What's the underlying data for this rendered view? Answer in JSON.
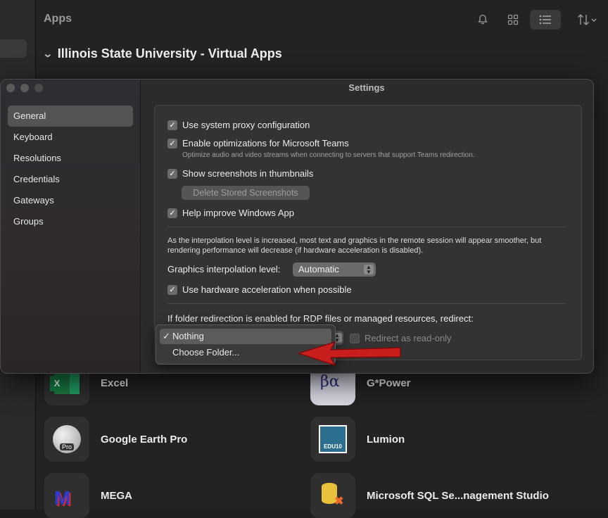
{
  "background": {
    "title": "Apps",
    "toolbar_icons": [
      "bell-icon",
      "grid-icon",
      "list-icon",
      "sort-icon"
    ],
    "group": {
      "name": "Illinois State University - Virtual Apps",
      "chevron": "chevron-down"
    },
    "apps": [
      {
        "name": "Excel",
        "icon": "excel-icon",
        "icon_text": "X"
      },
      {
        "name": "G*Power",
        "icon": "gpower-icon",
        "icon_text": "βα"
      },
      {
        "name": "Google Earth Pro",
        "icon": "google-earth-icon",
        "icon_text": "Pro"
      },
      {
        "name": "Lumion",
        "icon": "lumion-icon",
        "icon_text": "EDU10"
      },
      {
        "name": "MEGA",
        "icon": "mega-icon",
        "icon_text": "M"
      },
      {
        "name": "Microsoft SQL Se...nagement Studio",
        "icon": "sql-server-icon",
        "icon_text": ""
      }
    ]
  },
  "settings": {
    "title": "Settings",
    "sidebar": [
      {
        "label": "General",
        "active": true
      },
      {
        "label": "Keyboard"
      },
      {
        "label": "Resolutions"
      },
      {
        "label": "Credentials"
      },
      {
        "label": "Gateways"
      },
      {
        "label": "Groups"
      }
    ],
    "general": {
      "use_system_proxy": {
        "label": "Use system proxy configuration",
        "checked": true
      },
      "teams_opt": {
        "label": "Enable optimizations for Microsoft Teams",
        "checked": true,
        "description": "Optimize audio and video streams when connecting to servers that support Teams redirection."
      },
      "screenshots": {
        "label": "Show screenshots in thumbnails",
        "checked": true
      },
      "delete_screenshots_button": "Delete Stored Screenshots",
      "help_improve": {
        "label": "Help improve Windows App",
        "checked": true
      },
      "interpolation_note": "As the interpolation level is increased, most text and graphics in the remote session will appear smoother, but rendering performance will decrease (if hardware acceleration is disabled).",
      "interpolation_label": "Graphics interpolation level:",
      "interpolation_value": "Automatic",
      "hardware_accel": {
        "label": "Use hardware acceleration when possible",
        "checked": true
      },
      "folder_redirect_label": "If folder redirection is enabled for RDP files or managed resources, redirect:",
      "redirect_readonly": {
        "label": "Redirect as read-only",
        "checked": false
      }
    },
    "redirect_menu": {
      "items": [
        {
          "label": "Nothing",
          "selected": true,
          "check": "✓"
        },
        {
          "label": "Choose Folder..."
        }
      ]
    }
  },
  "annotation": {
    "arrow_color": "#c81e1e"
  }
}
